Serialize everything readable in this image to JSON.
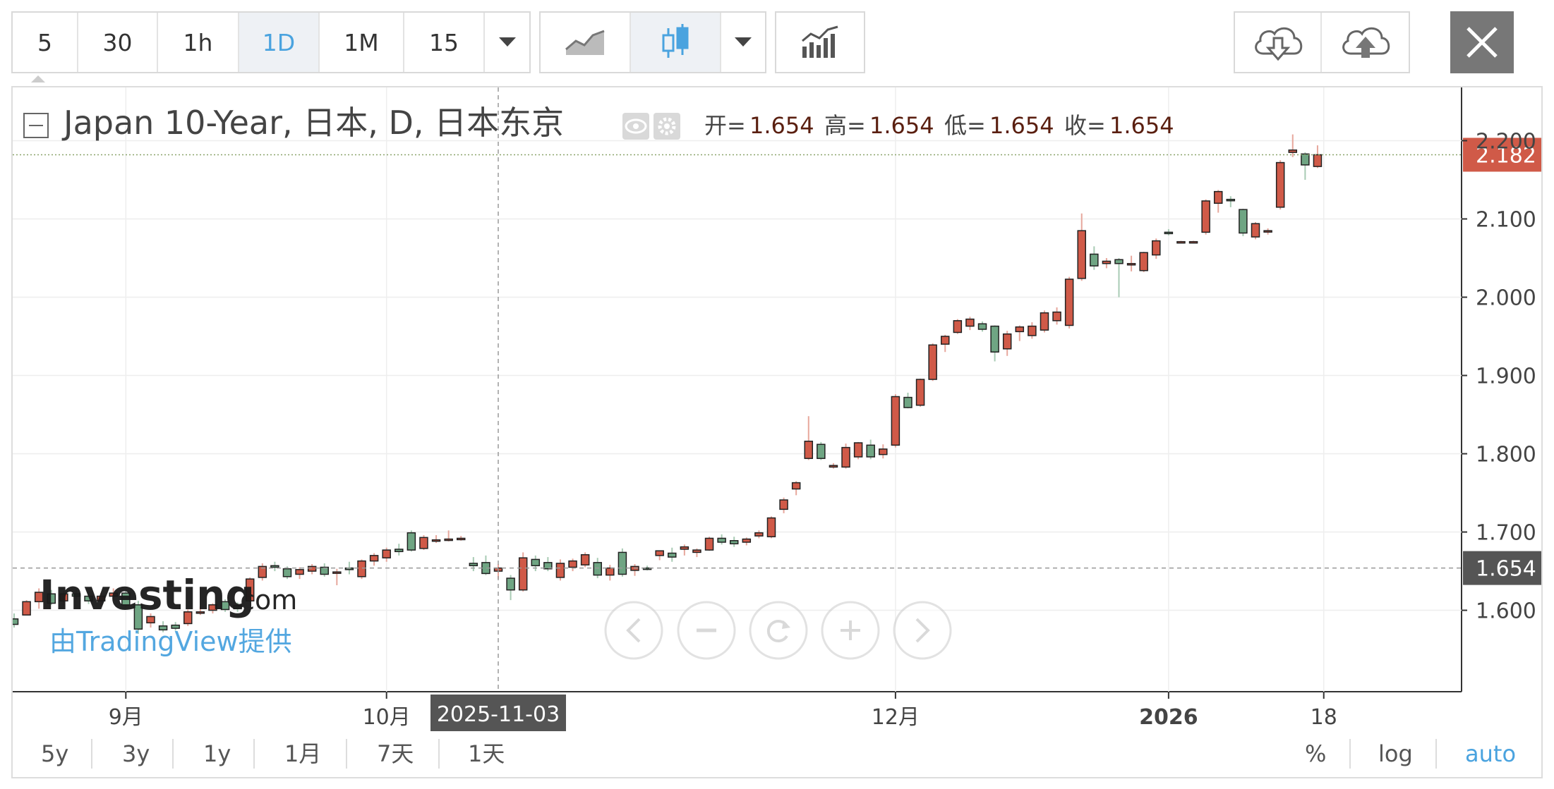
{
  "toolbar": {
    "intervals": [
      "5",
      "30",
      "1h",
      "1D",
      "1M",
      "15"
    ],
    "active_interval": "1D"
  },
  "legend": {
    "title": "Japan 10-Year, 日本, D, 日本东京",
    "open_label": "开=",
    "open": "1.654",
    "high_label": "高=",
    "high": "1.654",
    "low_label": "低=",
    "low": "1.654",
    "close_label": "收=",
    "close": "1.654"
  },
  "watermark": {
    "brand": "Investing",
    "brand_suffix": ".com",
    "provider": "由TradingView提供"
  },
  "crosshair": {
    "date_label": "2025-11-03",
    "price_label": "1.654",
    "price": 1.654
  },
  "last_price": {
    "label": "2.182",
    "value": 2.182
  },
  "colors": {
    "up": "#d05a48",
    "down": "#6fa583",
    "accent": "#4aa3df",
    "last_price_bg": "#d05a48",
    "crosshair_label_bg": "#555555"
  },
  "bottom_ranges": [
    "5y",
    "3y",
    "1y",
    "1月",
    "7天",
    "1天"
  ],
  "scale_options": [
    "%",
    "log",
    "auto"
  ],
  "active_scale": "auto",
  "chart_data": {
    "type": "candlestick",
    "title": "Japan 10-Year",
    "y_ticks": [
      1.6,
      1.7,
      1.8,
      1.9,
      2.0,
      2.1,
      2.2
    ],
    "y_tick_labels": [
      "1.600",
      "1.700",
      "1.800",
      "1.900",
      "2.000",
      "2.100",
      "2.200"
    ],
    "ylim": [
      1.496,
      2.268
    ],
    "x_tick_labels": [
      {
        "label": "9月",
        "bold": false,
        "index": 9
      },
      {
        "label": "10月",
        "bold": false,
        "index": 30
      },
      {
        "label": "12月",
        "bold": false,
        "index": 71
      },
      {
        "label": "2026",
        "bold": true,
        "index": 93
      },
      {
        "label": "18",
        "bold": false,
        "index": 105.5
      }
    ],
    "grid": true,
    "candles": [
      [
        1.589,
        1.596,
        1.578,
        1.582
      ],
      [
        1.594,
        1.613,
        1.594,
        1.611
      ],
      [
        1.611,
        1.628,
        1.602,
        1.623
      ],
      [
        1.621,
        1.626,
        1.607,
        1.609
      ],
      [
        1.612,
        1.625,
        1.606,
        1.621
      ],
      [
        1.621,
        1.627,
        1.614,
        1.618
      ],
      [
        1.618,
        1.624,
        1.608,
        1.612
      ],
      [
        1.612,
        1.622,
        1.606,
        1.618
      ],
      [
        1.618,
        1.628,
        1.612,
        1.622
      ],
      [
        1.622,
        1.627,
        1.604,
        1.607
      ],
      [
        1.607,
        1.612,
        1.57,
        1.576
      ],
      [
        1.584,
        1.596,
        1.578,
        1.592
      ],
      [
        1.58,
        1.586,
        1.572,
        1.575
      ],
      [
        1.581,
        1.585,
        1.574,
        1.577
      ],
      [
        1.583,
        1.601,
        1.58,
        1.598
      ],
      [
        1.598,
        1.605,
        1.594,
        1.598
      ],
      [
        1.6,
        1.609,
        1.596,
        1.607
      ],
      [
        1.611,
        1.614,
        1.598,
        1.601
      ],
      [
        1.606,
        1.61,
        1.598,
        1.602
      ],
      [
        1.612,
        1.642,
        1.61,
        1.64
      ],
      [
        1.642,
        1.66,
        1.638,
        1.656
      ],
      [
        1.657,
        1.662,
        1.65,
        1.655
      ],
      [
        1.653,
        1.656,
        1.64,
        1.643
      ],
      [
        1.646,
        1.655,
        1.64,
        1.652
      ],
      [
        1.65,
        1.659,
        1.646,
        1.656
      ],
      [
        1.655,
        1.66,
        1.643,
        1.646
      ],
      [
        1.648,
        1.653,
        1.632,
        1.649
      ],
      [
        1.654,
        1.662,
        1.646,
        1.652
      ],
      [
        1.643,
        1.665,
        1.64,
        1.663
      ],
      [
        1.663,
        1.673,
        1.657,
        1.67
      ],
      [
        1.667,
        1.68,
        1.662,
        1.677
      ],
      [
        1.678,
        1.685,
        1.67,
        1.675
      ],
      [
        1.699,
        1.702,
        1.675,
        1.677
      ],
      [
        1.679,
        1.696,
        1.677,
        1.693
      ],
      [
        1.69,
        1.696,
        1.686,
        1.69
      ],
      [
        1.69,
        1.702,
        1.688,
        1.691
      ],
      [
        1.692,
        1.695,
        1.689,
        1.692
      ],
      [
        1.66,
        1.668,
        1.65,
        1.657
      ],
      [
        1.661,
        1.67,
        1.645,
        1.647
      ],
      [
        1.65,
        1.659,
        1.64,
        1.654
      ],
      [
        1.641,
        1.645,
        1.613,
        1.626
      ],
      [
        1.626,
        1.674,
        1.624,
        1.667
      ],
      [
        1.665,
        1.67,
        1.65,
        1.657
      ],
      [
        1.661,
        1.668,
        1.65,
        1.653
      ],
      [
        1.642,
        1.665,
        1.638,
        1.66
      ],
      [
        1.655,
        1.666,
        1.65,
        1.663
      ],
      [
        1.658,
        1.674,
        1.655,
        1.671
      ],
      [
        1.661,
        1.667,
        1.641,
        1.645
      ],
      [
        1.645,
        1.658,
        1.638,
        1.654
      ],
      [
        1.674,
        1.679,
        1.643,
        1.646
      ],
      [
        1.651,
        1.659,
        1.644,
        1.656
      ],
      [
        1.654,
        1.657,
        1.651,
        1.653
      ],
      [
        1.67,
        1.676,
        1.664,
        1.676
      ],
      [
        1.673,
        1.68,
        1.662,
        1.668
      ],
      [
        1.678,
        1.684,
        1.67,
        1.681
      ],
      [
        1.674,
        1.679,
        1.668,
        1.677
      ],
      [
        1.677,
        1.694,
        1.676,
        1.692
      ],
      [
        1.692,
        1.697,
        1.684,
        1.687
      ],
      [
        1.689,
        1.694,
        1.681,
        1.685
      ],
      [
        1.687,
        1.693,
        1.683,
        1.691
      ],
      [
        1.695,
        1.702,
        1.692,
        1.699
      ],
      [
        1.694,
        1.72,
        1.692,
        1.718
      ],
      [
        1.729,
        1.744,
        1.724,
        1.741
      ],
      [
        1.755,
        1.765,
        1.747,
        1.763
      ],
      [
        1.794,
        1.848,
        1.792,
        1.816
      ],
      [
        1.812,
        1.815,
        1.792,
        1.794
      ],
      [
        1.783,
        1.788,
        1.781,
        1.785
      ],
      [
        1.783,
        1.813,
        1.781,
        1.808
      ],
      [
        1.796,
        1.815,
        1.793,
        1.814
      ],
      [
        1.811,
        1.818,
        1.793,
        1.796
      ],
      [
        1.799,
        1.812,
        1.794,
        1.806
      ],
      [
        1.811,
        1.876,
        1.808,
        1.873
      ],
      [
        1.872,
        1.878,
        1.858,
        1.859
      ],
      [
        1.862,
        1.896,
        1.86,
        1.895
      ],
      [
        1.895,
        1.941,
        1.893,
        1.939
      ],
      [
        1.94,
        1.952,
        1.93,
        1.95
      ],
      [
        1.955,
        1.972,
        1.953,
        1.97
      ],
      [
        1.963,
        1.975,
        1.958,
        1.972
      ],
      [
        1.966,
        1.969,
        1.956,
        1.959
      ],
      [
        1.963,
        1.964,
        1.918,
        1.93
      ],
      [
        1.934,
        1.957,
        1.925,
        1.953
      ],
      [
        1.956,
        1.964,
        1.944,
        1.962
      ],
      [
        1.951,
        1.968,
        1.947,
        1.963
      ],
      [
        1.958,
        1.983,
        1.955,
        1.98
      ],
      [
        1.97,
        1.987,
        1.965,
        1.981
      ],
      [
        1.964,
        2.026,
        1.96,
        2.023
      ],
      [
        2.024,
        2.107,
        2.021,
        2.085
      ],
      [
        2.055,
        2.065,
        2.035,
        2.04
      ],
      [
        2.043,
        2.05,
        2.037,
        2.046
      ],
      [
        2.048,
        2.05,
        2.0,
        2.043
      ],
      [
        2.043,
        2.053,
        2.033,
        2.043
      ],
      [
        2.034,
        2.058,
        2.032,
        2.057
      ],
      [
        2.054,
        2.075,
        2.049,
        2.072
      ],
      [
        2.083,
        2.087,
        2.079,
        2.082
      ],
      [
        2.071,
        2.072,
        2.069,
        2.071
      ],
      [
        2.071,
        2.072,
        2.069,
        2.071
      ],
      [
        2.083,
        2.125,
        2.08,
        2.123
      ],
      [
        2.12,
        2.137,
        2.108,
        2.135
      ],
      [
        2.125,
        2.129,
        2.115,
        2.124
      ],
      [
        2.112,
        2.113,
        2.078,
        2.082
      ],
      [
        2.077,
        2.096,
        2.074,
        2.094
      ],
      [
        2.084,
        2.088,
        2.08,
        2.085
      ],
      [
        2.115,
        2.175,
        2.112,
        2.172
      ],
      [
        2.185,
        2.208,
        2.179,
        2.188
      ],
      [
        2.183,
        2.185,
        2.15,
        2.169
      ],
      [
        2.167,
        2.194,
        2.165,
        2.182
      ]
    ]
  }
}
